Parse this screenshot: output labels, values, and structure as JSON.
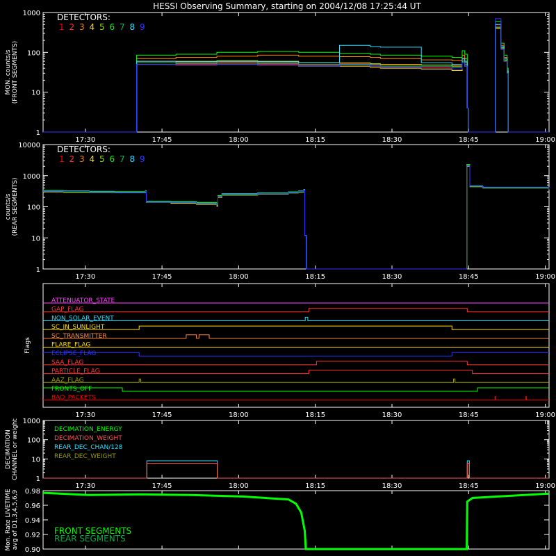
{
  "title": "HESSI Observing Summary, starting on 2004/12/08 17:25:44 UT",
  "colors": {
    "detectors": [
      "#ff0000",
      "#ff3333",
      "#ff8800",
      "#ffdd00",
      "#99dd00",
      "#00ff00",
      "#00bb66",
      "#33ddff",
      "#3333ff"
    ],
    "line": "#ffffff"
  },
  "chart_data": [
    {
      "type": "line",
      "id": "front",
      "ylabel": [
        "MON. counts/s",
        "(FRONT SEGMENTS)"
      ],
      "legend_title": "DETECTORS:",
      "legend_numbers": [
        "1",
        "2",
        "3",
        "4",
        "5",
        "6",
        "7",
        "8",
        "9"
      ],
      "yscale": "log",
      "ylim": [
        1,
        1000
      ],
      "yticks": [
        "1",
        "10",
        "100",
        "1000"
      ],
      "xticks": [
        "17:30",
        "17:45",
        "18:00",
        "18:15",
        "18:30",
        "18:45",
        "19:00"
      ],
      "x_range_min": [
        -4,
        95
      ],
      "x": [
        -4,
        14.2,
        14.3,
        22,
        30,
        38,
        46,
        54,
        60,
        62,
        70,
        76,
        78,
        78.5,
        79,
        79.2,
        79.5,
        84.3,
        84.5,
        85.6,
        86.2,
        86.8,
        87,
        87.5,
        95
      ],
      "series": [
        {
          "values": [
            1,
            1,
            55,
            50,
            52,
            50,
            45,
            48,
            45,
            42,
            42,
            42,
            60,
            50,
            4,
            1,
            1,
            1,
            400,
            120,
            60,
            30,
            1,
            1,
            1
          ]
        },
        {
          "values": [
            1,
            1,
            60,
            55,
            58,
            55,
            50,
            52,
            50,
            48,
            48,
            47,
            65,
            55,
            4,
            1,
            1,
            1,
            450,
            130,
            65,
            32,
            1,
            1,
            1
          ]
        },
        {
          "values": [
            1,
            1,
            70,
            75,
            80,
            85,
            80,
            78,
            75,
            70,
            65,
            62,
            85,
            70,
            4,
            1,
            1,
            1,
            500,
            150,
            75,
            35,
            1,
            1,
            1
          ]
        },
        {
          "values": [
            1,
            1,
            50,
            48,
            50,
            48,
            45,
            45,
            42,
            40,
            38,
            35,
            55,
            45,
            4,
            1,
            1,
            1,
            400,
            120,
            60,
            30,
            1,
            1,
            1
          ]
        },
        {
          "values": [
            1,
            1,
            60,
            60,
            62,
            60,
            55,
            55,
            52,
            50,
            48,
            45,
            70,
            55,
            4,
            1,
            1,
            1,
            420,
            130,
            65,
            32,
            1,
            1,
            1
          ]
        },
        {
          "values": [
            1,
            1,
            85,
            90,
            100,
            105,
            100,
            95,
            90,
            85,
            80,
            75,
            110,
            90,
            4,
            1,
            1,
            1,
            600,
            170,
            85,
            40,
            1,
            1,
            1
          ]
        },
        {
          "values": [
            1,
            1,
            55,
            52,
            55,
            52,
            48,
            50,
            48,
            45,
            45,
            42,
            60,
            50,
            4,
            1,
            1,
            1,
            420,
            125,
            62,
            30,
            1,
            1,
            1
          ]
        },
        {
          "values": [
            1,
            1,
            60,
            58,
            60,
            58,
            55,
            150,
            140,
            135,
            55,
            50,
            70,
            60,
            4,
            1,
            1,
            1,
            500,
            140,
            70,
            33,
            1,
            1,
            1
          ]
        },
        {
          "values": [
            1,
            1,
            50,
            48,
            50,
            48,
            45,
            48,
            45,
            42,
            40,
            38,
            55,
            45,
            4,
            1,
            1,
            1,
            700,
            120,
            60,
            30,
            1,
            1,
            1
          ]
        }
      ]
    },
    {
      "type": "line",
      "id": "rear",
      "ylabel": [
        "counts/s",
        "(REAR SEGMENTS)"
      ],
      "legend_title": "DETECTORS:",
      "legend_numbers": [
        "1",
        "2",
        "3",
        "4",
        "5",
        "6",
        "7",
        "8",
        "9"
      ],
      "yscale": "log",
      "ylim": [
        1,
        10000
      ],
      "yticks": [
        "1",
        "10",
        "100",
        "1000",
        "10000"
      ],
      "xticks": [
        "17:30",
        "17:45",
        "18:00",
        "18:15",
        "18:30",
        "18:45",
        "19:00"
      ],
      "x_range_min": [
        -4,
        95
      ],
      "x": [
        -4,
        0,
        5,
        10,
        16,
        16.2,
        21,
        26,
        30,
        30.2,
        31,
        38,
        44,
        46,
        47,
        47.2,
        47.5,
        52,
        62,
        78.8,
        78.9,
        79.5,
        82,
        82.1,
        95
      ],
      "series": [
        {
          "values": [
            310,
            300,
            290,
            280,
            300,
            140,
            135,
            125,
            110,
            210,
            240,
            260,
            280,
            300,
            340,
            12,
            1,
            1,
            1,
            1,
            2000,
            450,
            420,
            410,
            360
          ]
        },
        {
          "values": [
            320,
            310,
            300,
            290,
            310,
            145,
            140,
            130,
            120,
            220,
            250,
            270,
            290,
            310,
            350,
            12,
            1,
            1,
            1,
            1,
            2100,
            460,
            430,
            415,
            365
          ]
        },
        {
          "values": [
            330,
            320,
            310,
            300,
            320,
            150,
            145,
            135,
            125,
            225,
            260,
            280,
            300,
            320,
            360,
            12,
            1,
            1,
            1,
            1,
            2200,
            470,
            440,
            420,
            370
          ]
        },
        {
          "values": [
            300,
            290,
            285,
            280,
            295,
            140,
            130,
            120,
            105,
            200,
            235,
            255,
            275,
            295,
            330,
            12,
            1,
            1,
            1,
            1,
            2000,
            440,
            410,
            400,
            350
          ]
        },
        {
          "values": [
            315,
            305,
            295,
            285,
            305,
            145,
            138,
            128,
            115,
            215,
            245,
            265,
            285,
            305,
            345,
            12,
            1,
            1,
            1,
            1,
            2050,
            455,
            425,
            410,
            362
          ]
        },
        {
          "values": [
            335,
            325,
            315,
            305,
            325,
            152,
            148,
            138,
            128,
            230,
            262,
            282,
            302,
            322,
            362,
            12,
            1,
            1,
            1,
            1,
            2300,
            475,
            445,
            425,
            372
          ]
        },
        {
          "values": [
            312,
            302,
            292,
            282,
            302,
            142,
            136,
            126,
            112,
            212,
            242,
            262,
            282,
            302,
            342,
            12,
            1,
            1,
            1,
            1,
            2050,
            452,
            422,
            405,
            358
          ]
        },
        {
          "values": [
            325,
            315,
            305,
            295,
            315,
            148,
            142,
            132,
            122,
            222,
            255,
            275,
            295,
            315,
            355,
            12,
            1,
            1,
            1,
            1,
            2150,
            465,
            435,
            418,
            368
          ]
        },
        {
          "values": [
            320,
            310,
            300,
            290,
            310,
            145,
            140,
            130,
            118,
            218,
            250,
            270,
            290,
            310,
            350,
            12,
            1,
            1,
            1,
            1,
            2100,
            460,
            430,
            415,
            365
          ]
        }
      ]
    },
    {
      "type": "line",
      "id": "flags",
      "ylabel": [
        "Flags"
      ],
      "xticks": [
        "17:30",
        "17:45",
        "18:00",
        "18:15",
        "18:30",
        "18:45",
        "19:00"
      ],
      "x_range_min": [
        -4,
        95
      ],
      "flags": [
        {
          "name": "ATTENUATOR_STATE",
          "color": "#ff44ff",
          "transitions": []
        },
        {
          "name": "GAP_FLAG",
          "color": "#ff3333",
          "transitions": [
            [
              -4,
              0
            ],
            [
              48,
              1
            ],
            [
              79,
              0
            ]
          ]
        },
        {
          "name": "NON_SOLAR_EVENT",
          "color": "#33ddff",
          "transitions": [
            [
              -4,
              0
            ],
            [
              47.3,
              1
            ],
            [
              47.8,
              0
            ]
          ]
        },
        {
          "name": "SC_IN_SUNLIGHT",
          "color": "#ffdd00",
          "transitions": [
            [
              -4,
              0
            ],
            [
              14.8,
              1
            ],
            [
              76,
              0
            ]
          ]
        },
        {
          "name": "SC_TRANSMITTER",
          "color": "#ff8844",
          "transitions": [
            [
              -4,
              0
            ],
            [
              24,
              1
            ],
            [
              26,
              0
            ],
            [
              26.5,
              1
            ],
            [
              28.5,
              0
            ]
          ]
        },
        {
          "name": "FLARE_FLAG",
          "color": "#ffdd00",
          "transitions": []
        },
        {
          "name": "ECLIPSE_FLAG",
          "color": "#3333ff",
          "transitions": [
            [
              -4,
              1
            ],
            [
              14.8,
              0
            ],
            [
              76,
              1
            ]
          ]
        },
        {
          "name": "SAA_FLAG",
          "color": "#ff3333",
          "transitions": [
            [
              -4,
              0
            ],
            [
              49.5,
              1
            ],
            [
              79,
              0
            ]
          ]
        },
        {
          "name": "PARTICLE_FLAG",
          "color": "#ff3333",
          "transitions": [
            [
              -4,
              0
            ],
            [
              48,
              1
            ],
            [
              80,
              0
            ]
          ]
        },
        {
          "name": "AAZ_FLAG",
          "color": "#999900",
          "transitions": [
            [
              -4,
              0
            ],
            [
              14.8,
              1
            ],
            [
              15.1,
              0
            ],
            [
              76.3,
              1
            ],
            [
              76.6,
              0
            ]
          ]
        },
        {
          "name": "FRONTS_OFF",
          "color": "#00ff00",
          "transitions": [
            [
              -4,
              1
            ],
            [
              11.5,
              0
            ],
            [
              81,
              1
            ]
          ]
        },
        {
          "name": "BAD_PACKETS",
          "color": "#ff0000",
          "transitions": [
            [
              -4,
              0
            ],
            [
              84.4,
              1
            ],
            [
              84.6,
              0
            ],
            [
              90.4,
              1
            ],
            [
              90.6,
              0
            ]
          ]
        }
      ]
    },
    {
      "type": "line",
      "id": "decimation",
      "ylabel": [
        "DECIMATION",
        "CHANNEL or weight"
      ],
      "yscale": "log",
      "ylim": [
        1,
        1000
      ],
      "yticks": [
        "1",
        "10",
        "100",
        "1000"
      ],
      "xticks": [
        "17:30",
        "17:45",
        "18:00",
        "18:15",
        "18:30",
        "18:45",
        "19:00"
      ],
      "x_range_min": [
        -4,
        95
      ],
      "legend": [
        {
          "name": "DECIMATION_ENERGY",
          "color": "#00ff00"
        },
        {
          "name": "DECIMATION_WEIGHT",
          "color": "#ff5555"
        },
        {
          "name": "REAR_DEC_CHAN/128",
          "color": "#33ddff"
        },
        {
          "name": "REAR_DEC_WEIGHT",
          "color": "#999900"
        }
      ],
      "series": [
        {
          "name": "REAR_DEC_CHAN/128",
          "x": [
            -4,
            16.2,
            16.3,
            30,
            30.1,
            78.9,
            79,
            79.3,
            79.4,
            95
          ],
          "values": [
            1,
            1,
            8,
            8,
            1,
            1,
            8,
            8,
            1,
            1
          ]
        },
        {
          "name": "REAR_DEC_WEIGHT",
          "x": [
            -4,
            16.2,
            16.3,
            30,
            30.1,
            78.9,
            79,
            79.3,
            79.4,
            95
          ],
          "values": [
            1,
            1,
            6,
            6,
            1,
            1,
            6,
            6,
            1,
            1
          ]
        },
        {
          "name": "DECIMATION_WEIGHT",
          "x": [
            -4,
            16.2,
            16.3,
            30,
            30.1,
            78.9,
            79,
            79.3,
            79.4,
            95
          ],
          "values": [
            1,
            1,
            6,
            6,
            1,
            1,
            6,
            6,
            1,
            1
          ]
        }
      ]
    },
    {
      "type": "line",
      "id": "livetime",
      "ylabel": [
        "Mon. Rate LIVETIME",
        "avg of D1,3,4,5,6,9"
      ],
      "ylim": [
        0.9,
        0.98
      ],
      "yticks": [
        "0.90",
        "0.92",
        "0.94",
        "0.96",
        "0.98"
      ],
      "x_range_min": [
        -4,
        95
      ],
      "legend": [
        {
          "name": "FRONT SEGMENTS",
          "color": "#00ff00"
        },
        {
          "name": "REAR SEGMENTS",
          "color": "#00aa44"
        }
      ],
      "x": [
        -4,
        5,
        15,
        25,
        35,
        44,
        45.5,
        46.5,
        47.2,
        47.4,
        47.5,
        78.9,
        79,
        80,
        85,
        95
      ],
      "series": [
        {
          "name": "FRONT SEGMENTS",
          "values": [
            0.977,
            0.974,
            0.975,
            0.974,
            0.972,
            0.968,
            0.962,
            0.95,
            0.925,
            0.9,
            0.9,
            0.9,
            0.965,
            0.97,
            0.972,
            0.976
          ]
        }
      ]
    }
  ]
}
